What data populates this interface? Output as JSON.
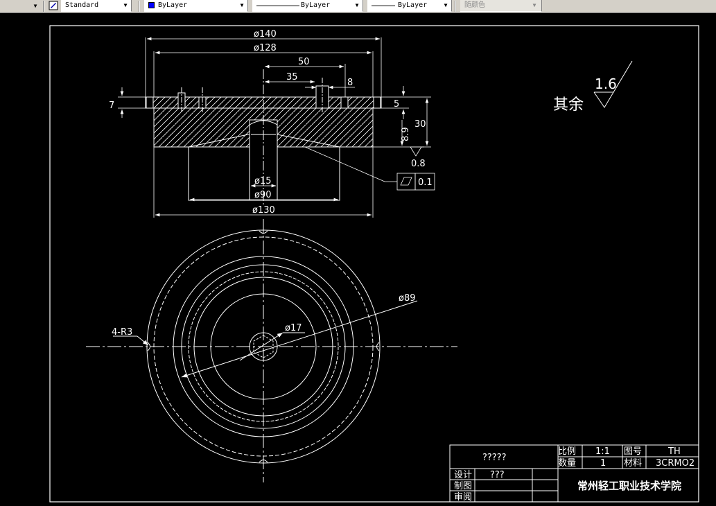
{
  "toolbar": {
    "text_style": "Standard",
    "color": "ByLayer",
    "linetype": "ByLayer",
    "lineweight": "ByLayer",
    "plot_style": "随颜色",
    "accent_color": "#0000ff"
  },
  "drawing": {
    "dim_d140": "ø140",
    "dim_d128": "ø128",
    "dim_50": "50",
    "dim_35": "35",
    "dim_8": "8",
    "dim_7": "7",
    "dim_5": "5",
    "dim_30": "30",
    "dim_8_9": "8.9",
    "dim_d15": "ø15",
    "dim_d90": "ø90",
    "dim_d130": "ø130",
    "flatness_value": "0.1",
    "roughness_note": "其余",
    "roughness_value": "1.6",
    "roughness_small": "0.8",
    "dim_d89": "ø89",
    "dim_d17": "ø17",
    "radius_note": "4-R3"
  },
  "title_block": {
    "part_name": "?????",
    "scale_label": "比例",
    "scale_value": "1:1",
    "drawing_no_label": "图号",
    "drawing_no_value": "TH",
    "quantity_label": "数量",
    "quantity_value": "1",
    "material_label": "材料",
    "material_value": "3CRMO2",
    "design_label": "设计",
    "design_value": "???",
    "drafting_label": "制图",
    "review_label": "审阅",
    "school": "常州轻工职业技术学院"
  }
}
